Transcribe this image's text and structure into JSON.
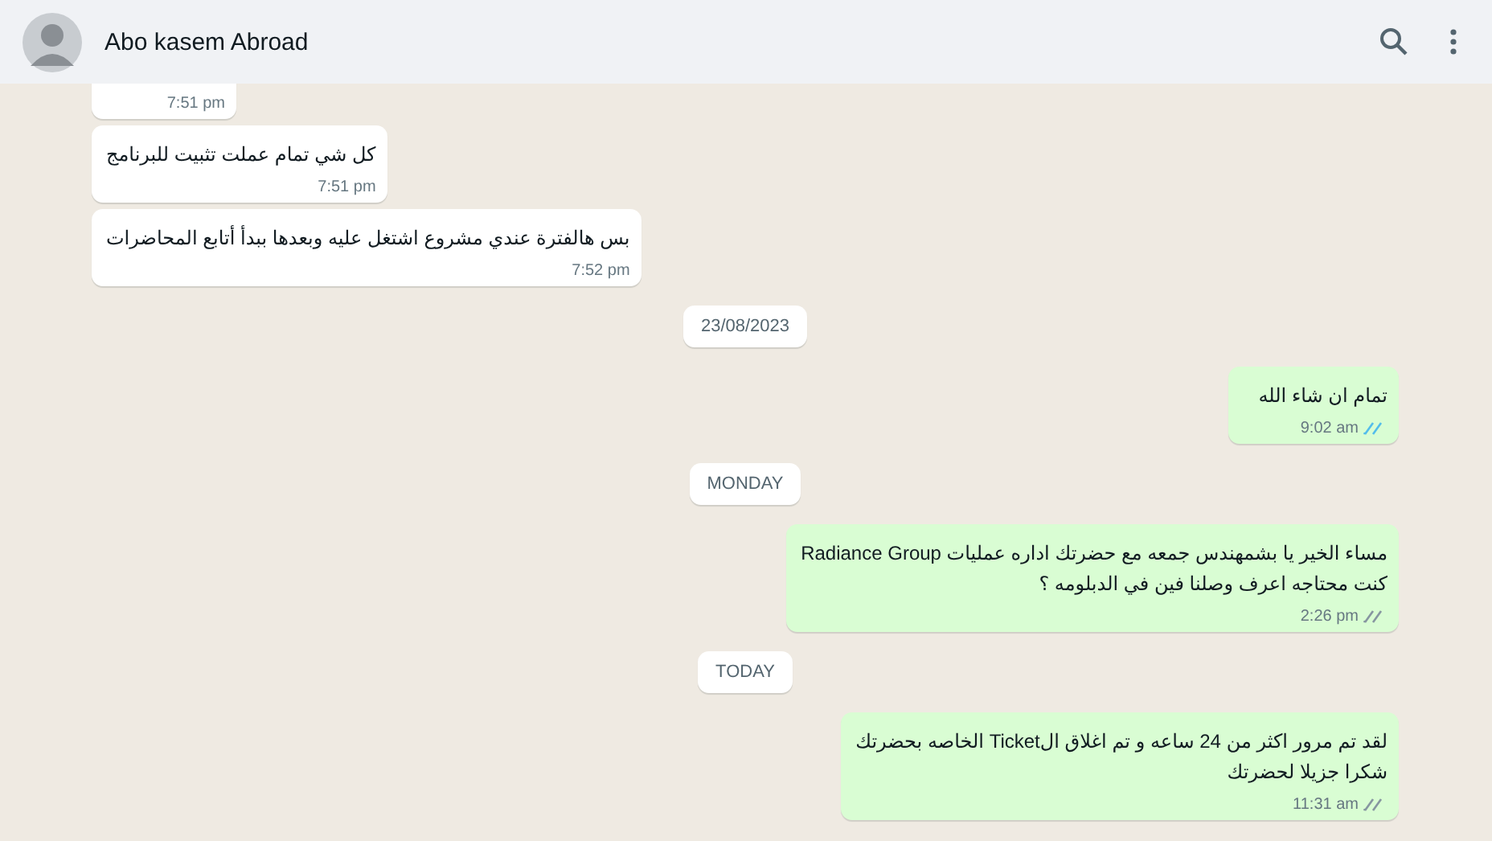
{
  "header": {
    "contact_name": "Abo kasem Abroad"
  },
  "messages": [
    {
      "kind": "message",
      "outgoing": false,
      "time": "7:51 pm",
      "clipped": true
    },
    {
      "kind": "message",
      "outgoing": false,
      "text": "كل شي تمام عملت تثبيت للبرنامج",
      "time": "7:51 pm",
      "clipped": false
    },
    {
      "kind": "message",
      "outgoing": false,
      "text": "بس هالفترة عندي مشروع اشتغل عليه وبعدها ببدأ أتابع المحاضرات",
      "time": "7:52 pm",
      "clipped": false
    },
    {
      "kind": "date",
      "text": "23/08/2023"
    },
    {
      "kind": "message",
      "outgoing": true,
      "text": "تمام ان شاء الله",
      "time": "9:02 am",
      "read": true,
      "clipped": false
    },
    {
      "kind": "date",
      "text": "MONDAY"
    },
    {
      "kind": "message",
      "outgoing": true,
      "text": "مساء الخير يا بشمهندس جمعه مع حضرتك اداره عمليات Radiance Group\nكنت محتاجه اعرف وصلنا فين في الدبلومه  ؟",
      "time": "2:26 pm",
      "read": false,
      "clipped": false
    },
    {
      "kind": "date",
      "text": "TODAY"
    },
    {
      "kind": "message",
      "outgoing": true,
      "text": "لقد تم مرور اكثر من  24 ساعه و تم اغلاق الTicket الخاصه بحضرتك\nشكرا جزيلا لحضرتك",
      "time": "11:31 am",
      "read": false,
      "clipped": false
    }
  ]
}
